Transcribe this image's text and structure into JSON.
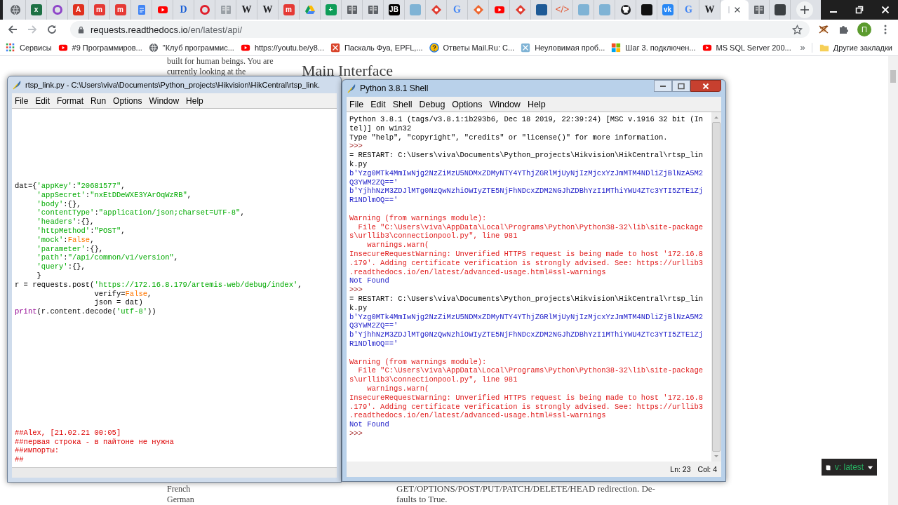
{
  "tabs": [
    {
      "kind": "globe",
      "selected": false
    },
    {
      "kind": "tile",
      "color": "#1d7044",
      "glyph": "x",
      "selected": false
    },
    {
      "kind": "ring",
      "color": "#8e44c9",
      "selected": false
    },
    {
      "kind": "tile",
      "color": "#e0301e",
      "glyph": "A",
      "selected": false
    },
    {
      "kind": "tile",
      "color": "#e53935",
      "glyph": "m",
      "selected": false
    },
    {
      "kind": "tile",
      "color": "#e53935",
      "glyph": "m",
      "selected": false
    },
    {
      "kind": "doc",
      "color": "#4285f4",
      "selected": false
    },
    {
      "kind": "play",
      "color": "#ff0000",
      "selected": false
    },
    {
      "kind": "letter",
      "color": "#1a5fd6",
      "glyph": "D",
      "selected": false
    },
    {
      "kind": "ring",
      "color": "#e0202c",
      "selected": false
    },
    {
      "kind": "reader",
      "color": "#9aa0a6",
      "selected": false
    },
    {
      "kind": "letter",
      "color": "#202124",
      "glyph": "W",
      "selected": false
    },
    {
      "kind": "letter",
      "color": "#202124",
      "glyph": "W",
      "selected": false
    },
    {
      "kind": "tile",
      "color": "#e53935",
      "glyph": "m",
      "selected": false
    },
    {
      "kind": "drive",
      "selected": false
    },
    {
      "kind": "tile",
      "color": "#0f9d58",
      "glyph": "+",
      "selected": false
    },
    {
      "kind": "reader",
      "color": "#5f6368",
      "selected": false
    },
    {
      "kind": "reader",
      "color": "#5f6368",
      "selected": false
    },
    {
      "kind": "tile",
      "color": "#000000",
      "glyph": "JB",
      "selected": false
    },
    {
      "kind": "tile",
      "color": "#7fb3d5",
      "selected": false
    },
    {
      "kind": "diamond",
      "color": "#e03a2f",
      "selected": false
    },
    {
      "kind": "letter",
      "color": "#4285f4",
      "glyph": "G",
      "selected": false
    },
    {
      "kind": "diamond",
      "color": "#ee672f",
      "selected": false
    },
    {
      "kind": "play",
      "color": "#ff0000",
      "selected": false
    },
    {
      "kind": "diamond",
      "color": "#e03a2f",
      "selected": false
    },
    {
      "kind": "tile",
      "color": "#1e5a96",
      "selected": false
    },
    {
      "kind": "letter",
      "color": "#e44d26",
      "glyph": "</>",
      "selected": false
    },
    {
      "kind": "tile",
      "color": "#7fb3d5",
      "selected": false
    },
    {
      "kind": "tile",
      "color": "#7fb3d5",
      "selected": false
    },
    {
      "kind": "github",
      "color": "#202124",
      "selected": false
    },
    {
      "kind": "tile",
      "color": "#111111",
      "selected": false
    },
    {
      "kind": "tile",
      "color": "#2787f5",
      "glyph": "vk",
      "selected": false
    },
    {
      "kind": "letter",
      "color": "#4285f4",
      "glyph": "G",
      "selected": false
    },
    {
      "kind": "letter",
      "color": "#202124",
      "glyph": "W",
      "selected": false
    },
    {
      "kind": "page",
      "selected": true
    },
    {
      "kind": "reader",
      "color": "#5f6368",
      "selected": false
    },
    {
      "kind": "tile",
      "color": "#3c4043",
      "selected": false
    }
  ],
  "address": {
    "host": "requests.readthedocs.io",
    "path": "/en/latest/api/"
  },
  "profile": {
    "initial": "П"
  },
  "bookmarks": [
    {
      "kind": "apps",
      "label": "Сервисы"
    },
    {
      "kind": "play",
      "color": "#ff0000",
      "label": "#9 Программиров..."
    },
    {
      "kind": "globe",
      "label": "\"Клуб программис..."
    },
    {
      "kind": "play",
      "color": "#ff0000",
      "label": "https://youtu.be/y8..."
    },
    {
      "kind": "tile",
      "color": "#d9442b",
      "label": "Паскаль Фуа, EPFL,..."
    },
    {
      "kind": "help",
      "color": "#fbbc04",
      "label": "Ответы Mail.Ru: С..."
    },
    {
      "kind": "tile",
      "color": "#7fb3d5",
      "label": "Неуловимая проб..."
    },
    {
      "kind": "windows",
      "label": "Шаг 3. подключен..."
    },
    {
      "kind": "play",
      "color": "#ff0000",
      "label": "MS SQL Server 200..."
    }
  ],
  "bookmarks_more": "»",
  "other_bookmarks": "Другие закладки",
  "page": {
    "intro_lines": [
      "built for human beings. You are",
      "currently looking at the"
    ],
    "heading": "Main Interface",
    "languages": [
      "French",
      "German"
    ],
    "body_lines": [
      "GET/OPTIONS/POST/PUT/PATCH/DELETE/HEAD redirection. De-",
      "faults to True."
    ],
    "version_badge": "v: latest"
  },
  "editor": {
    "title": "rtsp_link.py - C:\\Users\\viva\\Documents\\Python_projects\\Hikvision\\HikCentral\\rtsp_link.",
    "menu": [
      "File",
      "Edit",
      "Format",
      "Run",
      "Options",
      "Window",
      "Help"
    ],
    "code_lines": [
      [
        {
          "kind": "plain",
          "text": "dat={"
        },
        {
          "kind": "string",
          "text": "'appKey'"
        },
        {
          "kind": "plain",
          "text": ":"
        },
        {
          "kind": "string",
          "text": "\"20681577\""
        },
        {
          "kind": "plain",
          "text": ","
        }
      ],
      [
        {
          "kind": "string",
          "text": "     'appSecret'"
        },
        {
          "kind": "plain",
          "text": ":"
        },
        {
          "kind": "string",
          "text": "\"nxEtDDeWXE3YArOqWzRB\""
        },
        {
          "kind": "plain",
          "text": ","
        }
      ],
      [
        {
          "kind": "string",
          "text": "     'body'"
        },
        {
          "kind": "plain",
          "text": ":{},"
        }
      ],
      [
        {
          "kind": "string",
          "text": "     'contentType'"
        },
        {
          "kind": "plain",
          "text": ":"
        },
        {
          "kind": "string",
          "text": "\"application/json;charset=UTF-8\""
        },
        {
          "kind": "plain",
          "text": ","
        }
      ],
      [
        {
          "kind": "string",
          "text": "     'headers'"
        },
        {
          "kind": "plain",
          "text": ":{},"
        }
      ],
      [
        {
          "kind": "string",
          "text": "     'httpMethod'"
        },
        {
          "kind": "plain",
          "text": ":"
        },
        {
          "kind": "string",
          "text": "\"POST\""
        },
        {
          "kind": "plain",
          "text": ","
        }
      ],
      [
        {
          "kind": "string",
          "text": "     'mock'"
        },
        {
          "kind": "plain",
          "text": ":"
        },
        {
          "kind": "keyword",
          "text": "False"
        },
        {
          "kind": "plain",
          "text": ","
        }
      ],
      [
        {
          "kind": "string",
          "text": "     'parameter'"
        },
        {
          "kind": "plain",
          "text": ":{},"
        }
      ],
      [
        {
          "kind": "string",
          "text": "     'path'"
        },
        {
          "kind": "plain",
          "text": ":"
        },
        {
          "kind": "string",
          "text": "\"/api/common/v1/version\""
        },
        {
          "kind": "plain",
          "text": ","
        }
      ],
      [
        {
          "kind": "string",
          "text": "     'query'"
        },
        {
          "kind": "plain",
          "text": ":{},"
        }
      ],
      [
        {
          "kind": "plain",
          "text": "     }"
        }
      ],
      [
        {
          "kind": "plain",
          "text": "r = requests.post("
        },
        {
          "kind": "string",
          "text": "'https://172.16.8.179/artemis-web/debug/index'"
        },
        {
          "kind": "plain",
          "text": ","
        }
      ],
      [
        {
          "kind": "plain",
          "text": "                  verify="
        },
        {
          "kind": "keyword",
          "text": "False"
        },
        {
          "kind": "plain",
          "text": ","
        }
      ],
      [
        {
          "kind": "plain",
          "text": "                  json = dat)"
        }
      ],
      [
        {
          "kind": "builtin",
          "text": "print"
        },
        {
          "kind": "plain",
          "text": "(r.content.decode("
        },
        {
          "kind": "string",
          "text": "'utf-8'"
        },
        {
          "kind": "plain",
          "text": "))"
        }
      ]
    ],
    "comment_lines": [
      "##Alex, [21.02.21 00:05]",
      "##первая строка - в пайтоне не нужна",
      "##импорты:",
      "##"
    ]
  },
  "shell": {
    "title": "Python 3.8.1 Shell",
    "menu": [
      "File",
      "Edit",
      "Shell",
      "Debug",
      "Options",
      "Window",
      "Help"
    ],
    "lines": [
      {
        "kind": "output",
        "text": "Python 3.8.1 (tags/v3.8.1:1b293b6, Dec 18 2019, 22:39:24) [MSC v.1916 32 bit (In"
      },
      {
        "kind": "output",
        "text": "tel)] on win32"
      },
      {
        "kind": "output",
        "text": "Type \"help\", \"copyright\", \"credits\" or \"license()\" for more information."
      },
      {
        "kind": "prompt",
        "text": ">>>"
      },
      {
        "kind": "output",
        "text": "= RESTART: C:\\Users\\viva\\Documents\\Python_projects\\Hikvision\\HikCentral\\rtsp_lin"
      },
      {
        "kind": "output",
        "text": "k.py"
      },
      {
        "kind": "stdout",
        "text": "b'Yzg0MTk4MmIwNjg2NzZiMzU5NDMxZDMyNTY4YThjZGRlMjUyNjIzMjcxYzJmMTM4NDliZjBlNzA5M2"
      },
      {
        "kind": "stdout",
        "text": "Q3YWM2ZQ=='"
      },
      {
        "kind": "stdout",
        "text": "b'YjhhNzM3ZDJlMTg0NzQwNzhiOWIyZTE5NjFhNDcxZDM2NGJhZDBhYzI1MThiYWU4ZTc3YTI5ZTE1Zj"
      },
      {
        "kind": "stdout",
        "text": "R1NDlmOQ=='"
      },
      {
        "kind": "blank"
      },
      {
        "kind": "stderr",
        "text": "Warning (from warnings module):"
      },
      {
        "kind": "stderr",
        "text": "  File \"C:\\Users\\viva\\AppData\\Local\\Programs\\Python\\Python38-32\\lib\\site-package"
      },
      {
        "kind": "stderr",
        "text": "s\\urllib3\\connectionpool.py\", line 981"
      },
      {
        "kind": "stderr",
        "text": "    warnings.warn("
      },
      {
        "kind": "stderr",
        "text": "InsecureRequestWarning: Unverified HTTPS request is being made to host '172.16.8"
      },
      {
        "kind": "stderr",
        "text": ".179'. Adding certificate verification is strongly advised. See: https://urllib3"
      },
      {
        "kind": "stderr",
        "text": ".readthedocs.io/en/latest/advanced-usage.html#ssl-warnings"
      },
      {
        "kind": "stdout",
        "text": "Not Found"
      },
      {
        "kind": "prompt",
        "text": ">>>"
      },
      {
        "kind": "output",
        "text": "= RESTART: C:\\Users\\viva\\Documents\\Python_projects\\Hikvision\\HikCentral\\rtsp_lin"
      },
      {
        "kind": "output",
        "text": "k.py"
      },
      {
        "kind": "stdout",
        "text": "b'Yzg0MTk4MmIwNjg2NzZiMzU5NDMxZDMyNTY4YThjZGRlMjUyNjIzMjcxYzJmMTM4NDliZjBlNzA5M2"
      },
      {
        "kind": "stdout",
        "text": "Q3YWM2ZQ=='"
      },
      {
        "kind": "stdout",
        "text": "b'YjhhNzM3ZDJlMTg0NzQwNzhiOWIyZTE5NjFhNDcxZDM2NGJhZDBhYzI1MThiYWU4ZTc3YTI5ZTE1Zj"
      },
      {
        "kind": "stdout",
        "text": "R1NDlmOQ=='"
      },
      {
        "kind": "blank"
      },
      {
        "kind": "stderr",
        "text": "Warning (from warnings module):"
      },
      {
        "kind": "stderr",
        "text": "  File \"C:\\Users\\viva\\AppData\\Local\\Programs\\Python\\Python38-32\\lib\\site-package"
      },
      {
        "kind": "stderr",
        "text": "s\\urllib3\\connectionpool.py\", line 981"
      },
      {
        "kind": "stderr",
        "text": "    warnings.warn("
      },
      {
        "kind": "stderr",
        "text": "InsecureRequestWarning: Unverified HTTPS request is being made to host '172.16.8"
      },
      {
        "kind": "stderr",
        "text": ".179'. Adding certificate verification is strongly advised. See: https://urllib3"
      },
      {
        "kind": "stderr",
        "text": ".readthedocs.io/en/latest/advanced-usage.html#ssl-warnings"
      },
      {
        "kind": "stdout",
        "text": "Not Found"
      },
      {
        "kind": "prompt",
        "text": ">>>"
      }
    ],
    "status": {
      "line": "Ln: 23",
      "col": "Col: 4"
    }
  }
}
